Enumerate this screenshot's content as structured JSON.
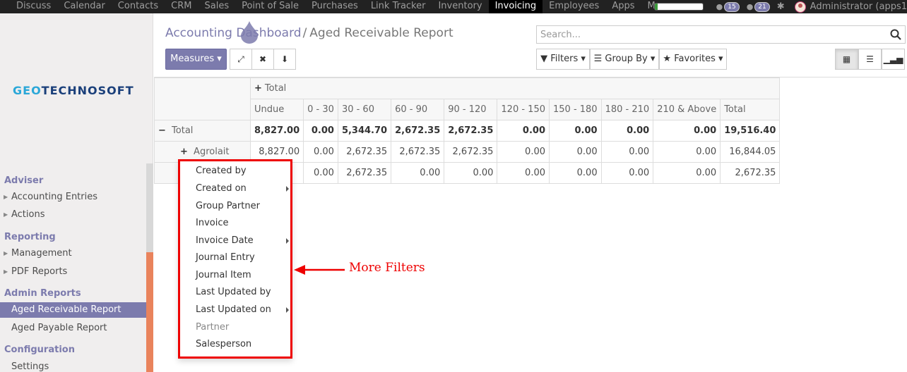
{
  "topnav": {
    "items": [
      "Discuss",
      "Calendar",
      "Contacts",
      "CRM",
      "Sales",
      "Point of Sale",
      "Purchases",
      "Link Tracker",
      "Inventory",
      "Invoicing",
      "Employees",
      "Apps",
      "More"
    ],
    "active": "Invoicing",
    "more_label": "More ▾",
    "badge_messages": "15",
    "badge_activities": "21",
    "user": "Administrator (apps1"
  },
  "sidebar": {
    "logo_prefix": "GEO",
    "logo_suffix": "TECHNOSOFT",
    "sections": {
      "adviser": "Adviser",
      "reporting": "Reporting",
      "admin_reports": "Admin Reports",
      "configuration": "Configuration"
    },
    "items": {
      "accounting_entries": "Accounting Entries",
      "actions": "Actions",
      "management": "Management",
      "pdf_reports": "PDF Reports",
      "aged_receivable": "Aged Receivable Report",
      "aged_payable": "Aged Payable Report",
      "settings": "Settings"
    }
  },
  "breadcrumb": {
    "parent": "Accounting Dashboard",
    "separator": "/",
    "current": "Aged Receivable Report"
  },
  "search": {
    "placeholder": "Search..."
  },
  "toolbar": {
    "measures": "Measures ▾",
    "filters": "Filters ▾",
    "group_by": "Group By ▾",
    "favorites": "Favorites ▾"
  },
  "pivot": {
    "col_group": "Total",
    "columns": [
      "Undue",
      "0 - 30",
      "30 - 60",
      "60 - 90",
      "90 - 120",
      "120 - 150",
      "150 - 180",
      "180 - 210",
      "210 & Above",
      "Total"
    ],
    "rows": [
      {
        "label": "Total",
        "values": [
          "8,827.00",
          "0.00",
          "5,344.70",
          "2,672.35",
          "2,672.35",
          "0.00",
          "0.00",
          "0.00",
          "0.00",
          "19,516.40"
        ]
      },
      {
        "label": "Agrolait",
        "values": [
          "8,827.00",
          "0.00",
          "2,672.35",
          "2,672.35",
          "2,672.35",
          "0.00",
          "0.00",
          "0.00",
          "0.00",
          "16,844.05"
        ]
      },
      {
        "label": "",
        "values": [
          "",
          "0.00",
          "2,672.35",
          "0.00",
          "0.00",
          "0.00",
          "0.00",
          "0.00",
          "0.00",
          "2,672.35"
        ]
      }
    ]
  },
  "dropdown": {
    "options": [
      "Created by",
      "Created on",
      "Group Partner",
      "Invoice",
      "Invoice Date",
      "Journal Entry",
      "Journal Item",
      "Last Updated by",
      "Last Updated on",
      "Partner",
      "Salesperson"
    ]
  },
  "annotation": {
    "text": "More Filters"
  },
  "colors": {
    "accent": "#7c7bad",
    "annotation": "#e00000",
    "sidebar_scroll": "#e9835c"
  }
}
